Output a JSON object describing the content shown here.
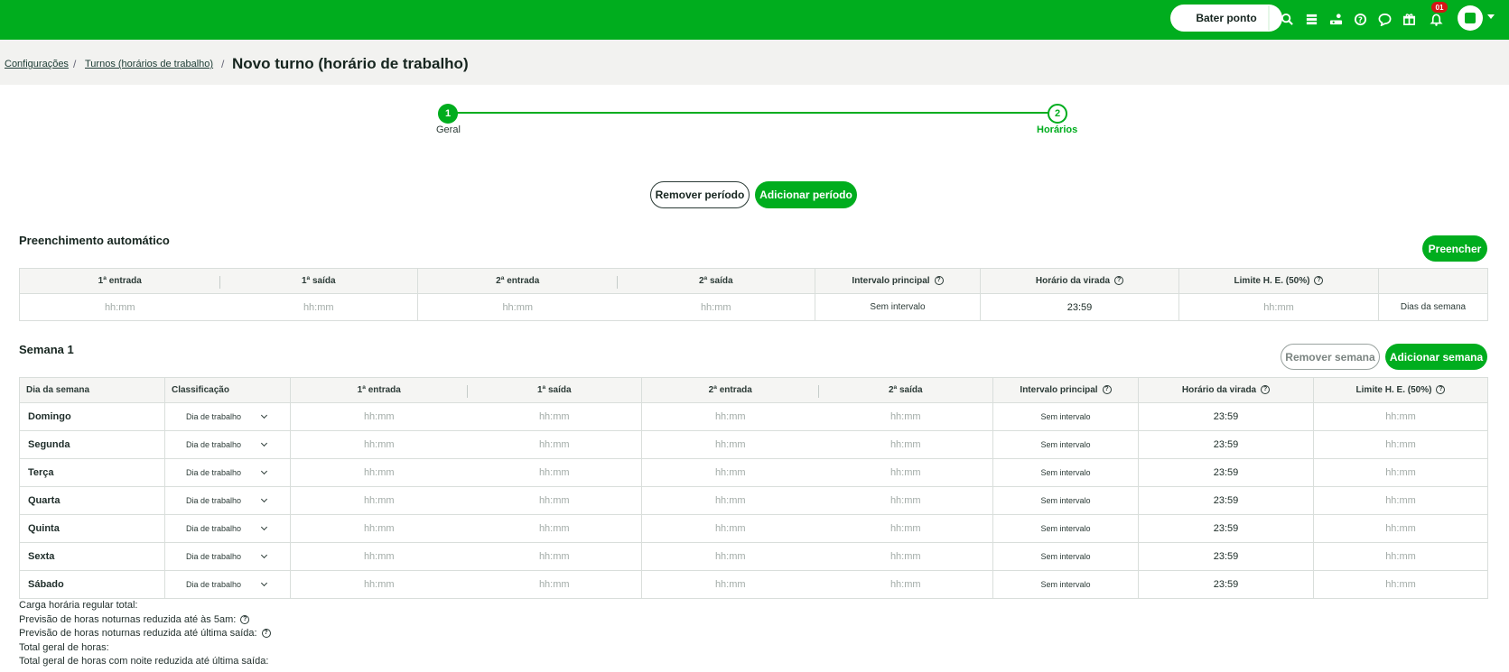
{
  "topbar": {
    "bater_ponto": "Bater ponto",
    "notification_count": "01",
    "icons": [
      "search-icon",
      "list-icon",
      "users-money-icon",
      "help-icon",
      "chat-icon",
      "gift-icon",
      "bell-icon"
    ]
  },
  "breadcrumb": {
    "items": [
      "Configurações",
      "Turnos (horários de trabalho)"
    ],
    "separator": "/",
    "current": "Novo turno (horário de trabalho)"
  },
  "stepper": {
    "steps": [
      {
        "number": "1",
        "label": "Geral"
      },
      {
        "number": "2",
        "label": "Horários"
      }
    ]
  },
  "period_actions": {
    "remove": "Remover período",
    "add": "Adicionar período"
  },
  "auto_fill": {
    "title": "Preenchimento automático",
    "button": "Preencher",
    "headers": [
      "1ª entrada",
      "1ª saída",
      "2ª entrada",
      "2ª saída",
      "Intervalo principal",
      "Horário da virada",
      "Limite H. E. (50%)",
      ""
    ],
    "row": {
      "entrada1": "hh:mm",
      "saida1": "hh:mm",
      "entrada2": "hh:mm",
      "saida2": "hh:mm",
      "intervalo": "Sem intervalo",
      "virada": "23:59",
      "limite": "hh:mm",
      "dias": "Dias da semana"
    }
  },
  "week": {
    "title": "Semana 1",
    "remove_button": "Remover semana",
    "add_button": "Adicionar semana",
    "headers": [
      "Dia da semana",
      "Classificação",
      "1ª entrada",
      "1ª saída",
      "2ª entrada",
      "2ª saída",
      "Intervalo principal",
      "Horário da virada",
      "Limite H. E. (50%)"
    ],
    "rows": [
      {
        "day": "Domingo",
        "class": "Dia de trabalho",
        "e1": "hh:mm",
        "s1": "hh:mm",
        "e2": "hh:mm",
        "s2": "hh:mm",
        "intervalo": "Sem intervalo",
        "virada": "23:59",
        "limite": "hh:mm"
      },
      {
        "day": "Segunda",
        "class": "Dia de trabalho",
        "e1": "hh:mm",
        "s1": "hh:mm",
        "e2": "hh:mm",
        "s2": "hh:mm",
        "intervalo": "Sem intervalo",
        "virada": "23:59",
        "limite": "hh:mm"
      },
      {
        "day": "Terça",
        "class": "Dia de trabalho",
        "e1": "hh:mm",
        "s1": "hh:mm",
        "e2": "hh:mm",
        "s2": "hh:mm",
        "intervalo": "Sem intervalo",
        "virada": "23:59",
        "limite": "hh:mm"
      },
      {
        "day": "Quarta",
        "class": "Dia de trabalho",
        "e1": "hh:mm",
        "s1": "hh:mm",
        "e2": "hh:mm",
        "s2": "hh:mm",
        "intervalo": "Sem intervalo",
        "virada": "23:59",
        "limite": "hh:mm"
      },
      {
        "day": "Quinta",
        "class": "Dia de trabalho",
        "e1": "hh:mm",
        "s1": "hh:mm",
        "e2": "hh:mm",
        "s2": "hh:mm",
        "intervalo": "Sem intervalo",
        "virada": "23:59",
        "limite": "hh:mm"
      },
      {
        "day": "Sexta",
        "class": "Dia de trabalho",
        "e1": "hh:mm",
        "s1": "hh:mm",
        "e2": "hh:mm",
        "s2": "hh:mm",
        "intervalo": "Sem intervalo",
        "virada": "23:59",
        "limite": "hh:mm"
      },
      {
        "day": "Sábado",
        "class": "Dia de trabalho",
        "e1": "hh:mm",
        "s1": "hh:mm",
        "e2": "hh:mm",
        "s2": "hh:mm",
        "intervalo": "Sem intervalo",
        "virada": "23:59",
        "limite": "hh:mm"
      }
    ]
  },
  "summary": [
    "Carga horária regular total:",
    "Previsão de horas noturnas reduzida até às 5am:",
    "Previsão de horas noturnas reduzida até última saída:",
    "Total geral de horas:",
    "Total geral de horas com noite reduzida até última saída:"
  ],
  "colors": {
    "brand": "#00ad1e",
    "badge": "#d51515"
  }
}
